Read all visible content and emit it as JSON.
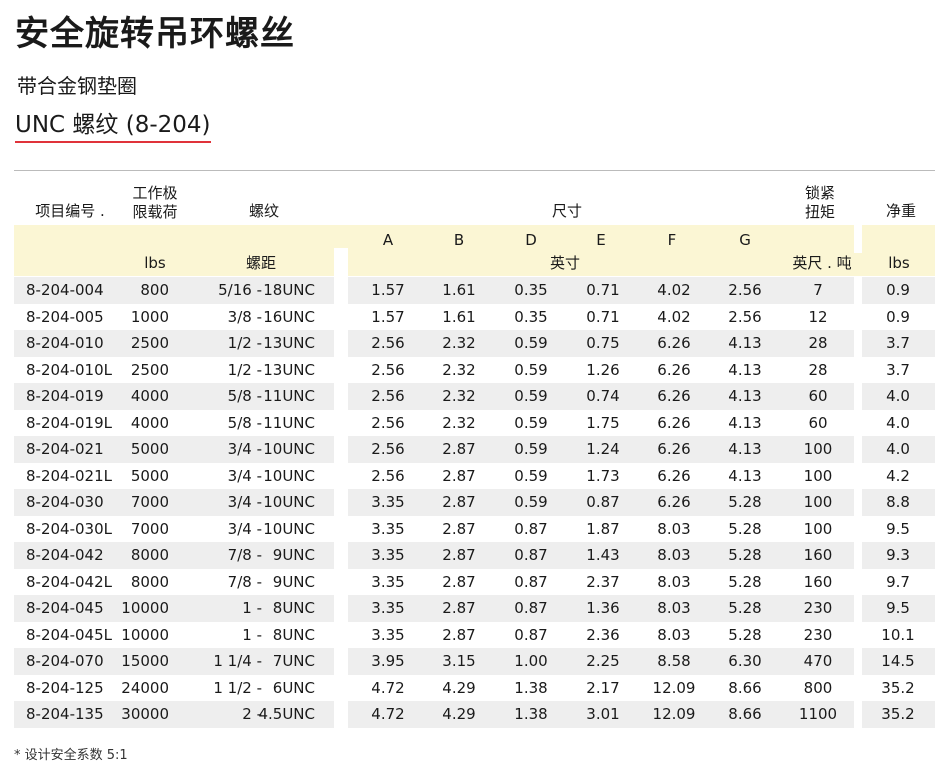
{
  "title": "安全旋转吊环螺丝",
  "subtitle": "带合金钢垫圈",
  "thread_label": "UNC 螺纹 (8-204)",
  "headers": {
    "item_no": "项目编号 .",
    "wll_line1": "工作极",
    "wll_line2": "限载荷",
    "thread": "螺纹",
    "size": "尺寸",
    "torque_line1": "锁紧",
    "torque_line2": "扭矩",
    "weight": "净重",
    "A": "A",
    "B": "B",
    "D": "D",
    "E": "E",
    "F": "F",
    "G": "G",
    "wll_unit": "lbs",
    "thread_unit": "螺距",
    "size_unit": "英寸",
    "torque_unit": "英尺 . 吨",
    "weight_unit": "lbs"
  },
  "rows": [
    {
      "item": "8-204-004",
      "wll": "800",
      "pitch": "5/16 -",
      "tpi": "18UNC",
      "A": "1.57",
      "B": "1.61",
      "D": "0.35",
      "E": "0.71",
      "F": "4.02",
      "G": "2.56",
      "torque": "7",
      "weight": "0.9"
    },
    {
      "item": "8-204-005",
      "wll": "1000",
      "pitch": "3/8 -",
      "tpi": "16UNC",
      "A": "1.57",
      "B": "1.61",
      "D": "0.35",
      "E": "0.71",
      "F": "4.02",
      "G": "2.56",
      "torque": "12",
      "weight": "0.9"
    },
    {
      "item": "8-204-010",
      "wll": "2500",
      "pitch": "1/2 -",
      "tpi": "13UNC",
      "A": "2.56",
      "B": "2.32",
      "D": "0.59",
      "E": "0.75",
      "F": "6.26",
      "G": "4.13",
      "torque": "28",
      "weight": "3.7"
    },
    {
      "item": "8-204-010L",
      "wll": "2500",
      "pitch": "1/2 -",
      "tpi": "13UNC",
      "A": "2.56",
      "B": "2.32",
      "D": "0.59",
      "E": "1.26",
      "F": "6.26",
      "G": "4.13",
      "torque": "28",
      "weight": "3.7"
    },
    {
      "item": "8-204-019",
      "wll": "4000",
      "pitch": "5/8 -",
      "tpi": "11UNC",
      "A": "2.56",
      "B": "2.32",
      "D": "0.59",
      "E": "0.74",
      "F": "6.26",
      "G": "4.13",
      "torque": "60",
      "weight": "4.0"
    },
    {
      "item": "8-204-019L",
      "wll": "4000",
      "pitch": "5/8 -",
      "tpi": "11UNC",
      "A": "2.56",
      "B": "2.32",
      "D": "0.59",
      "E": "1.75",
      "F": "6.26",
      "G": "4.13",
      "torque": "60",
      "weight": "4.0"
    },
    {
      "item": "8-204-021",
      "wll": "5000",
      "pitch": "3/4 -",
      "tpi": "10UNC",
      "A": "2.56",
      "B": "2.87",
      "D": "0.59",
      "E": "1.24",
      "F": "6.26",
      "G": "4.13",
      "torque": "100",
      "weight": "4.0"
    },
    {
      "item": "8-204-021L",
      "wll": "5000",
      "pitch": "3/4 -",
      "tpi": "10UNC",
      "A": "2.56",
      "B": "2.87",
      "D": "0.59",
      "E": "1.73",
      "F": "6.26",
      "G": "4.13",
      "torque": "100",
      "weight": "4.2"
    },
    {
      "item": "8-204-030",
      "wll": "7000",
      "pitch": "3/4 -",
      "tpi": "10UNC",
      "A": "3.35",
      "B": "2.87",
      "D": "0.59",
      "E": "0.87",
      "F": "6.26",
      "G": "5.28",
      "torque": "100",
      "weight": "8.8"
    },
    {
      "item": "8-204-030L",
      "wll": "7000",
      "pitch": "3/4 -",
      "tpi": "10UNC",
      "A": "3.35",
      "B": "2.87",
      "D": "0.87",
      "E": "1.87",
      "F": "8.03",
      "G": "5.28",
      "torque": "100",
      "weight": "9.5"
    },
    {
      "item": "8-204-042",
      "wll": "8000",
      "pitch": "7/8 -",
      "tpi": "9UNC",
      "A": "3.35",
      "B": "2.87",
      "D": "0.87",
      "E": "1.43",
      "F": "8.03",
      "G": "5.28",
      "torque": "160",
      "weight": "9.3"
    },
    {
      "item": "8-204-042L",
      "wll": "8000",
      "pitch": "7/8 -",
      "tpi": "9UNC",
      "A": "3.35",
      "B": "2.87",
      "D": "0.87",
      "E": "2.37",
      "F": "8.03",
      "G": "5.28",
      "torque": "160",
      "weight": "9.7"
    },
    {
      "item": "8-204-045",
      "wll": "10000",
      "pitch": "1 -",
      "tpi": "8UNC",
      "A": "3.35",
      "B": "2.87",
      "D": "0.87",
      "E": "1.36",
      "F": "8.03",
      "G": "5.28",
      "torque": "230",
      "weight": "9.5"
    },
    {
      "item": "8-204-045L",
      "wll": "10000",
      "pitch": "1 -",
      "tpi": "8UNC",
      "A": "3.35",
      "B": "2.87",
      "D": "0.87",
      "E": "2.36",
      "F": "8.03",
      "G": "5.28",
      "torque": "230",
      "weight": "10.1"
    },
    {
      "item": "8-204-070",
      "wll": "15000",
      "pitch": "1 1/4 -",
      "tpi": "7UNC",
      "A": "3.95",
      "B": "3.15",
      "D": "1.00",
      "E": "2.25",
      "F": "8.58",
      "G": "6.30",
      "torque": "470",
      "weight": "14.5"
    },
    {
      "item": "8-204-125",
      "wll": "24000",
      "pitch": "1 1/2 -",
      "tpi": "6UNC",
      "A": "4.72",
      "B": "4.29",
      "D": "1.38",
      "E": "2.17",
      "F": "12.09",
      "G": "8.66",
      "torque": "800",
      "weight": "35.2"
    },
    {
      "item": "8-204-135",
      "wll": "30000",
      "pitch": "2 -",
      "tpi": "4.5UNC",
      "A": "4.72",
      "B": "4.29",
      "D": "1.38",
      "E": "3.01",
      "F": "12.09",
      "G": "8.66",
      "torque": "1100",
      "weight": "35.2"
    }
  ],
  "footnote": "* 设计安全系数 5:1",
  "colors": {
    "accent_underline": "#e0333a",
    "header_band": "#fbf6d4",
    "row_alt": "#eeeeee"
  }
}
